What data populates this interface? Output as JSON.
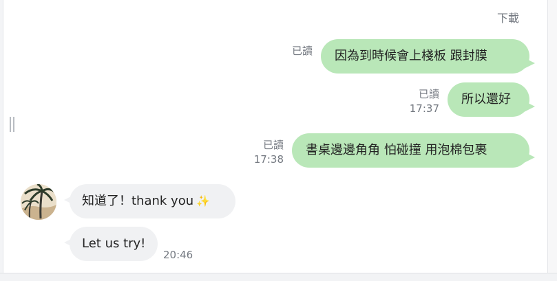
{
  "header": {
    "download_label": "下載"
  },
  "messages": [
    {
      "direction": "outgoing",
      "text": "因為到時候會上棧板 跟封膜",
      "read_label": "已讀",
      "time": ""
    },
    {
      "direction": "outgoing",
      "text": "所以還好",
      "read_label": "已讀",
      "time": "17:37"
    },
    {
      "direction": "outgoing",
      "text": "書桌邊邊角角 怕碰撞 用泡棉包裹",
      "read_label": "已讀",
      "time": "17:38"
    },
    {
      "direction": "incoming",
      "text": "知道了！thank you",
      "emoji": "sparkles-icon",
      "time": ""
    },
    {
      "direction": "incoming",
      "text": "Let us try!",
      "time": "20:46"
    }
  ],
  "contact": {
    "avatar": "palm-tree-avatar"
  },
  "colors": {
    "outgoing_bubble": "#b9e7b8",
    "incoming_bubble": "#f0f1f3",
    "meta_text": "#747981"
  }
}
